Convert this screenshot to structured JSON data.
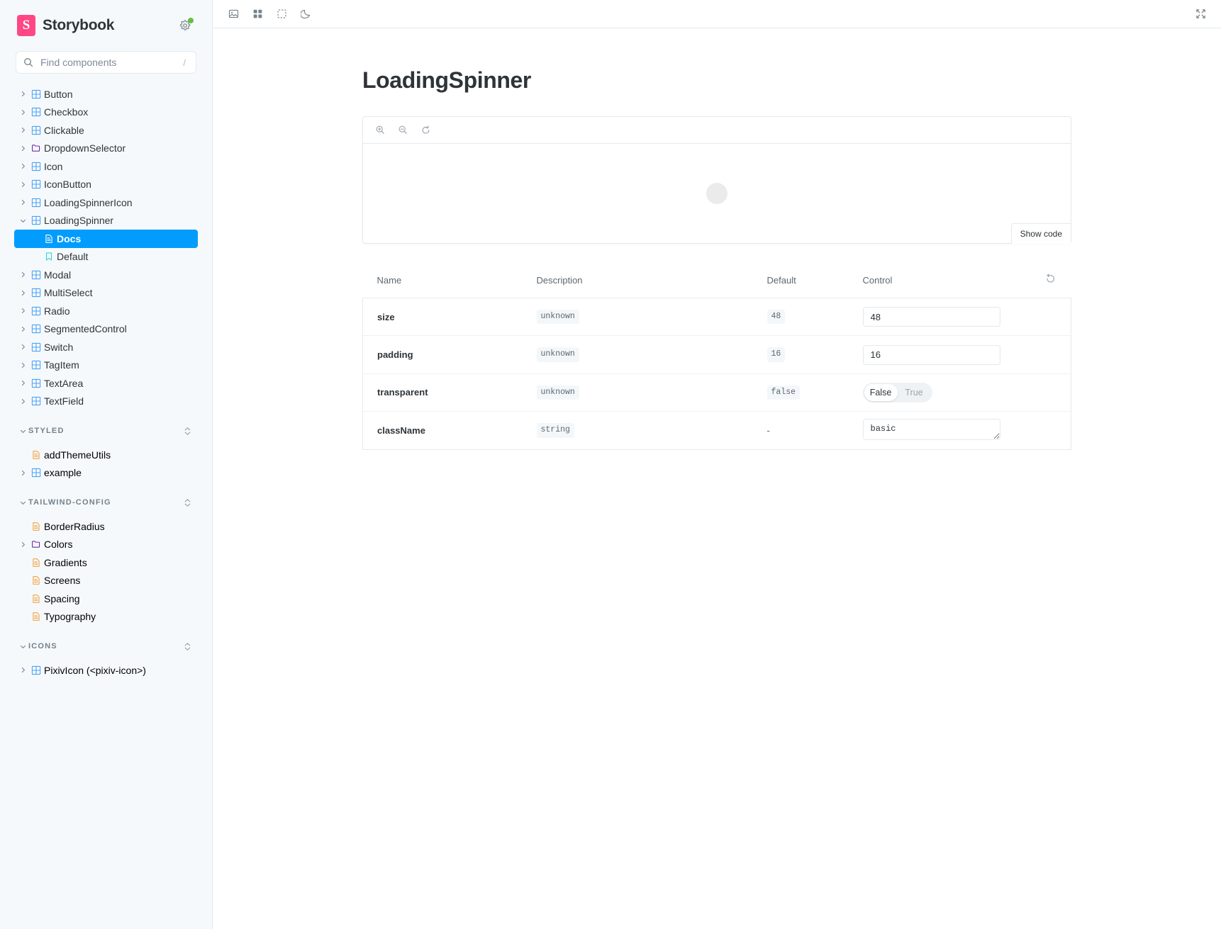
{
  "sidebar": {
    "brand": {
      "logo_letter": "S",
      "name": "Storybook"
    },
    "search": {
      "placeholder": "Find components",
      "value": "",
      "shortcut": "/"
    },
    "tree": [
      {
        "label": "Button",
        "icon": "component-icon",
        "expandable": true,
        "expanded": false,
        "depth": 0
      },
      {
        "label": "Checkbox",
        "icon": "component-icon",
        "expandable": true,
        "expanded": false,
        "depth": 0
      },
      {
        "label": "Clickable",
        "icon": "component-icon",
        "expandable": true,
        "expanded": false,
        "depth": 0
      },
      {
        "label": "DropdownSelector",
        "icon": "folder-icon",
        "expandable": true,
        "expanded": false,
        "depth": 0
      },
      {
        "label": "Icon",
        "icon": "component-icon",
        "expandable": true,
        "expanded": false,
        "depth": 0
      },
      {
        "label": "IconButton",
        "icon": "component-icon",
        "expandable": true,
        "expanded": false,
        "depth": 0
      },
      {
        "label": "LoadingSpinnerIcon",
        "icon": "component-icon",
        "expandable": true,
        "expanded": false,
        "depth": 0
      },
      {
        "label": "LoadingSpinner",
        "icon": "component-icon",
        "expandable": true,
        "expanded": true,
        "depth": 0
      },
      {
        "label": "Docs",
        "icon": "document-icon",
        "expandable": false,
        "selected": true,
        "depth": 1
      },
      {
        "label": "Default",
        "icon": "story-icon",
        "expandable": false,
        "selected": false,
        "depth": 1
      },
      {
        "label": "Modal",
        "icon": "component-icon",
        "expandable": true,
        "expanded": false,
        "depth": 0
      },
      {
        "label": "MultiSelect",
        "icon": "component-icon",
        "expandable": true,
        "expanded": false,
        "depth": 0
      },
      {
        "label": "Radio",
        "icon": "component-icon",
        "expandable": true,
        "expanded": false,
        "depth": 0
      },
      {
        "label": "SegmentedControl",
        "icon": "component-icon",
        "expandable": true,
        "expanded": false,
        "depth": 0
      },
      {
        "label": "Switch",
        "icon": "component-icon",
        "expandable": true,
        "expanded": false,
        "depth": 0
      },
      {
        "label": "TagItem",
        "icon": "component-icon",
        "expandable": true,
        "expanded": false,
        "depth": 0
      },
      {
        "label": "TextArea",
        "icon": "component-icon",
        "expandable": true,
        "expanded": false,
        "depth": 0
      },
      {
        "label": "TextField",
        "icon": "component-icon",
        "expandable": true,
        "expanded": false,
        "depth": 0
      }
    ],
    "sections": [
      {
        "title": "STYLED",
        "items": [
          {
            "label": "addThemeUtils",
            "icon": "doc-page-icon",
            "expandable": false
          },
          {
            "label": "example",
            "icon": "component-icon",
            "expandable": true
          }
        ]
      },
      {
        "title": "TAILWIND-CONFIG",
        "items": [
          {
            "label": "BorderRadius",
            "icon": "doc-page-icon",
            "expandable": false
          },
          {
            "label": "Colors",
            "icon": "folder-icon",
            "expandable": true
          },
          {
            "label": "Gradients",
            "icon": "doc-page-icon",
            "expandable": false
          },
          {
            "label": "Screens",
            "icon": "doc-page-icon",
            "expandable": false
          },
          {
            "label": "Spacing",
            "icon": "doc-page-icon",
            "expandable": false
          },
          {
            "label": "Typography",
            "icon": "doc-page-icon",
            "expandable": false
          }
        ]
      },
      {
        "title": "ICONS",
        "items": [
          {
            "label": "PixivIcon (<pixiv-icon>)",
            "icon": "component-icon",
            "expandable": true
          }
        ]
      }
    ]
  },
  "topbar": {
    "tools": [
      {
        "name": "backgrounds-icon",
        "title": "Change background"
      },
      {
        "name": "grid-icon",
        "title": "Apply grid"
      },
      {
        "name": "measure-icon",
        "title": "Measure"
      },
      {
        "name": "theme-moon-icon",
        "title": "Toggle theme"
      }
    ],
    "fullscreen": {
      "name": "collapse-icon",
      "title": "Go full screen"
    }
  },
  "doc": {
    "title": "LoadingSpinner",
    "preview": {
      "tools": [
        {
          "name": "zoom-in-icon",
          "title": "Zoom in"
        },
        {
          "name": "zoom-out-icon",
          "title": "Zoom out"
        },
        {
          "name": "zoom-reset-icon",
          "title": "Reset zoom"
        }
      ],
      "show_code_label": "Show code"
    },
    "args": {
      "headers": [
        "Name",
        "Description",
        "Default",
        "Control"
      ],
      "reset_icon": "reset-controls-icon",
      "rows": [
        {
          "name": "size",
          "description": "unknown",
          "default": "48",
          "default_is_chip": true,
          "control_type": "number",
          "control_value": "48"
        },
        {
          "name": "padding",
          "description": "unknown",
          "default": "16",
          "default_is_chip": true,
          "control_type": "number",
          "control_value": "16"
        },
        {
          "name": "transparent",
          "description": "unknown",
          "default": "false",
          "default_is_chip": true,
          "control_type": "boolean",
          "control_value": "False",
          "options": [
            "False",
            "True"
          ]
        },
        {
          "name": "className",
          "description": "string",
          "default": "-",
          "default_is_chip": false,
          "control_type": "text",
          "control_value": "basic"
        }
      ]
    }
  },
  "colors": {
    "accent": "#029CFD",
    "brand_pink": "#FF4785",
    "sidebar_bg": "#f6f9fc",
    "status_green": "#66BF3C",
    "component_icon": "#4BA3F5",
    "folder_icon": "#6F2CAC",
    "doc_icon": "#F2A03D",
    "story_icon": "#37D5D3"
  }
}
